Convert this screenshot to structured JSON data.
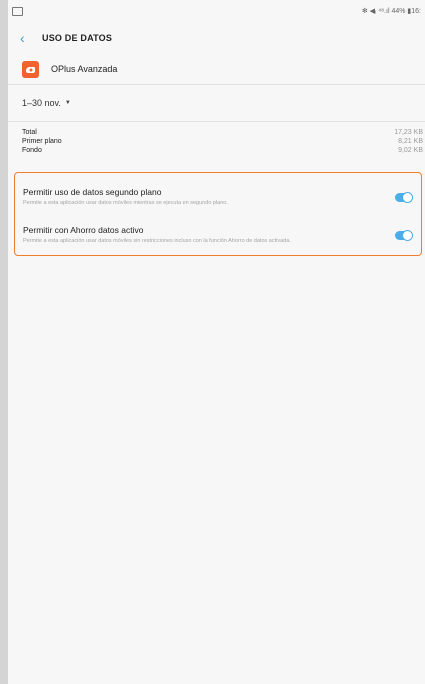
{
  "status_bar": {
    "right_text": "✻ ◀ᵢ ⁴⁸.ıl 44% ▮16:"
  },
  "header": {
    "back_icon": "chevron-left-icon",
    "title": "USO DE DATOS"
  },
  "app": {
    "icon": "oplus-app-icon",
    "name": "OPlus Avanzada"
  },
  "period": {
    "label": "1–30 nov.",
    "dropdown_icon": "caret-down-icon"
  },
  "stats": [
    {
      "label": "Total",
      "value": "17,23 KB"
    },
    {
      "label": "Primer plano",
      "value": "8,21 KB"
    },
    {
      "label": "Fondo",
      "value": "9,02 KB"
    }
  ],
  "toggles": [
    {
      "title": "Permitir uso de datos segundo plano",
      "description": "Permite a esta aplicación usar datos móviles mientras se ejecuta en segundo plano.",
      "on": true
    },
    {
      "title": "Permitir con Ahorro datos activo",
      "description": "Permite a esta aplicación usar datos móviles sin restricciones incluso con la función Ahorro de datos activada.",
      "on": true
    }
  ],
  "colors": {
    "accent": "#4aaee8",
    "highlight_border": "#f07d2c",
    "app_icon": "#f2622e"
  }
}
